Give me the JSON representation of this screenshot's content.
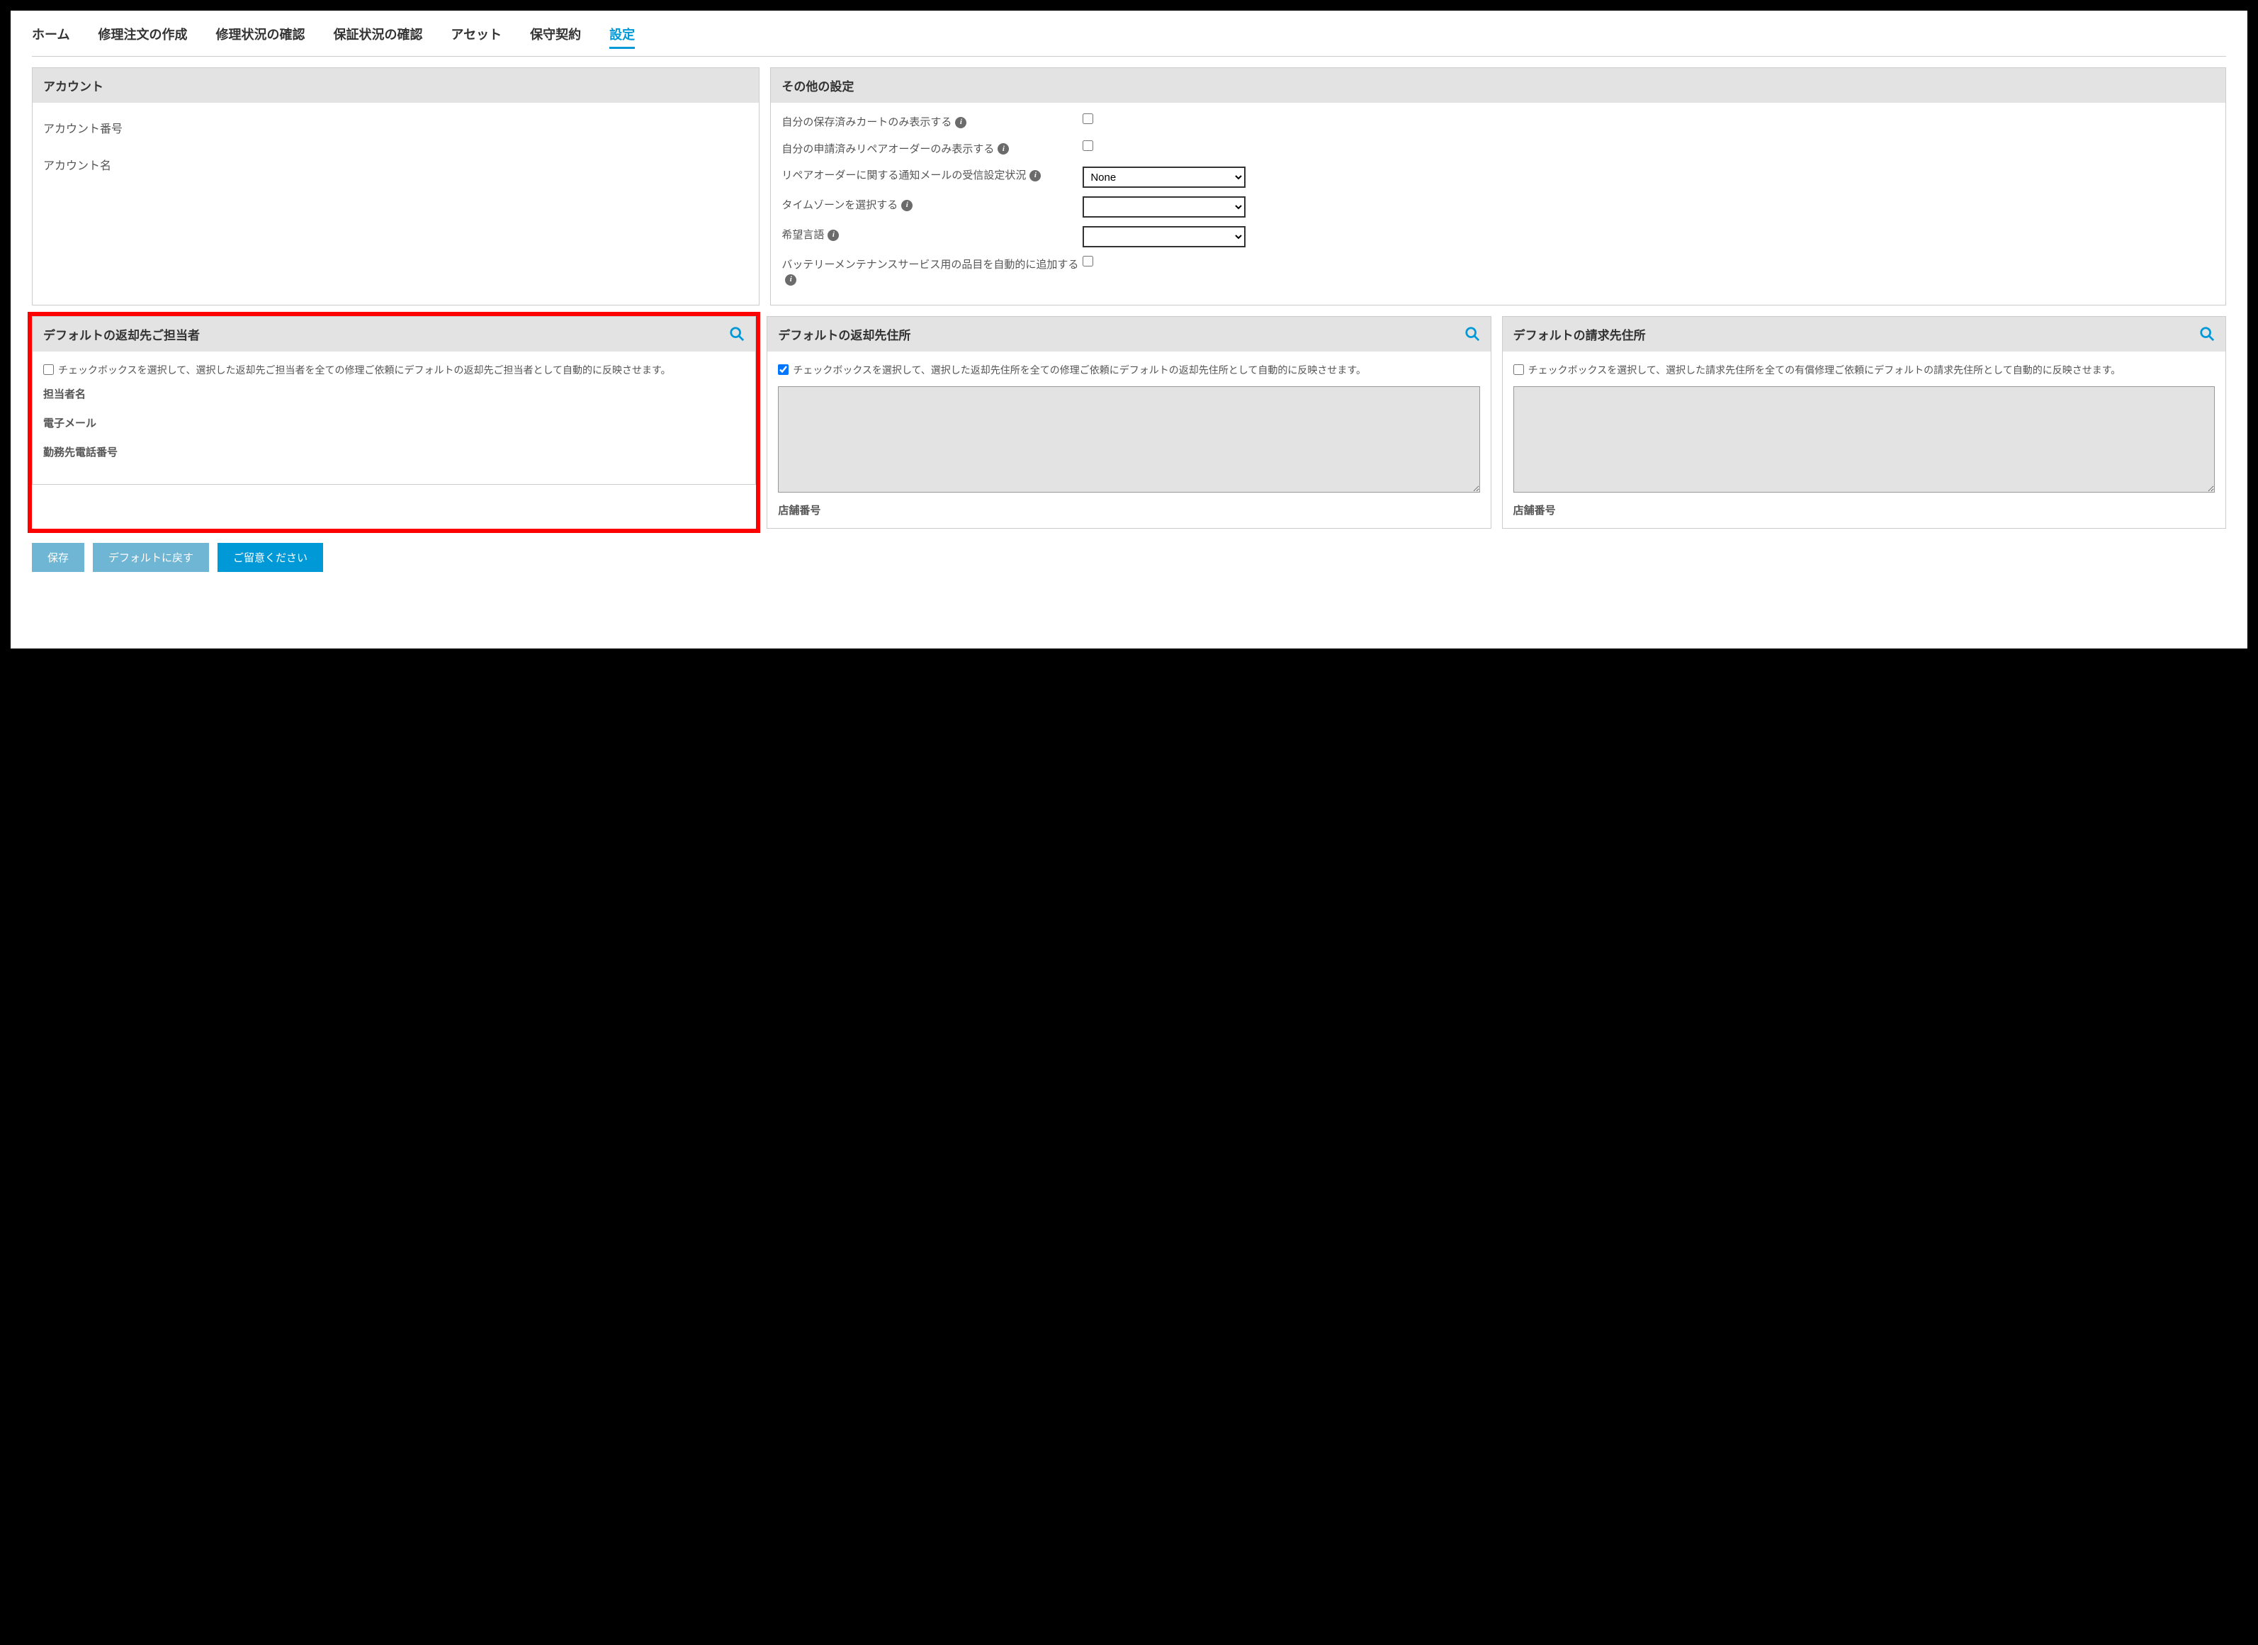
{
  "nav": {
    "tabs": [
      {
        "label": "ホーム",
        "active": false
      },
      {
        "label": "修理注文の作成",
        "active": false
      },
      {
        "label": "修理状況の確認",
        "active": false
      },
      {
        "label": "保証状況の確認",
        "active": false
      },
      {
        "label": "アセット",
        "active": false
      },
      {
        "label": "保守契約",
        "active": false
      },
      {
        "label": "設定",
        "active": true
      }
    ]
  },
  "account": {
    "title": "アカウント",
    "number_label": "アカウント番号",
    "name_label": "アカウント名"
  },
  "other_settings": {
    "title": "その他の設定",
    "show_own_carts_label": "自分の保存済みカートのみ表示する",
    "show_own_repair_orders_label": "自分の申請済みリペアオーダーのみ表示する",
    "repair_notification_label": "リペアオーダーに関する通知メールの受信設定状況",
    "repair_notification_value": "None",
    "timezone_label": "タイムゾーンを選択する",
    "timezone_value": "",
    "language_label": "希望言語",
    "language_value": "",
    "battery_service_label": "バッテリーメンテナンスサービス用の品目を自動的に追加する"
  },
  "default_return_contact": {
    "title": "デフォルトの返却先ご担当者",
    "checkbox_text": "チェックボックスを選択して、選択した返却先ご担当者を全ての修理ご依頼にデフォルトの返却先ご担当者として自動的に反映させます。",
    "checked": false,
    "contact_name_label": "担当者名",
    "email_label": "電子メール",
    "work_phone_label": "勤務先電話番号"
  },
  "default_return_address": {
    "title": "デフォルトの返却先住所",
    "checkbox_text": "チェックボックスを選択して、選択した返却先住所を全ての修理ご依頼にデフォルトの返却先住所として自動的に反映させます。",
    "checked": true,
    "address_value": "",
    "store_label": "店舗番号"
  },
  "default_billing_address": {
    "title": "デフォルトの請求先住所",
    "checkbox_text": "チェックボックスを選択して、選択した請求先住所を全ての有償修理ご依頼にデフォルトの請求先住所として自動的に反映させます。",
    "checked": false,
    "address_value": "",
    "store_label": "店舗番号"
  },
  "buttons": {
    "save": "保存",
    "reset": "デフォルトに戻す",
    "note": "ご留意ください"
  }
}
